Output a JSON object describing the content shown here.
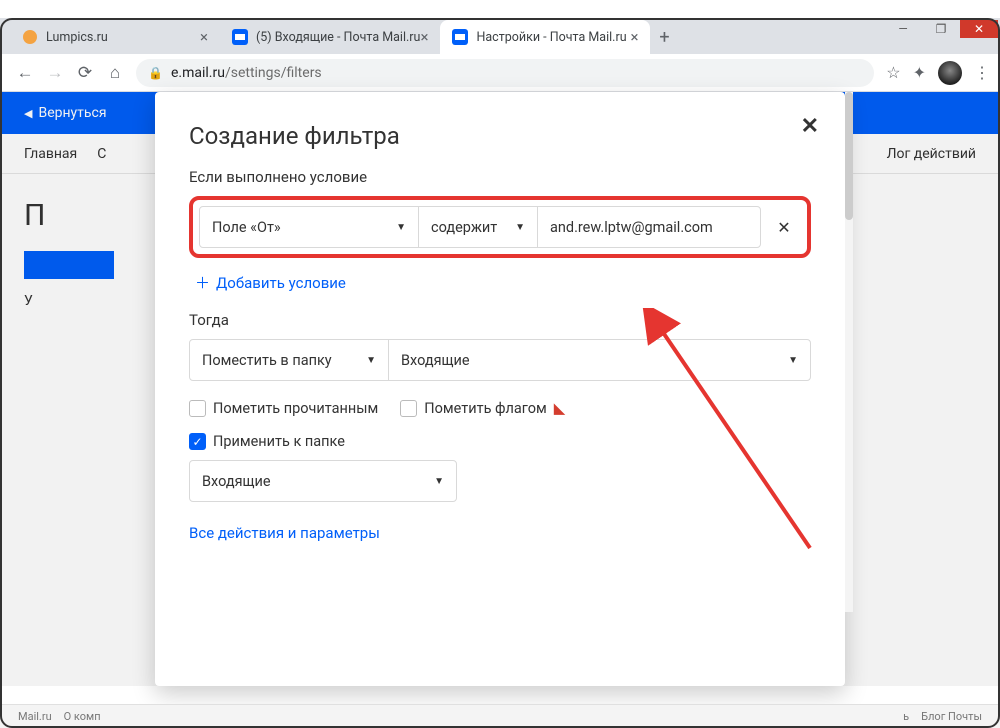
{
  "tabs": [
    {
      "label": "Lumpics.ru",
      "icon": "orange"
    },
    {
      "label": "(5) Входящие - Почта Mail.ru",
      "icon": "blue"
    },
    {
      "label": "Настройки - Почта Mail.ru",
      "icon": "blue"
    }
  ],
  "address": {
    "host": "e.mail.ru",
    "path": "/settings/filters"
  },
  "blueback": {
    "label": "Вернуться"
  },
  "nav": {
    "left": [
      "Главная",
      "С"
    ],
    "right": "Лог действий"
  },
  "pageBody": {
    "initial": "П",
    "under": "У"
  },
  "modal": {
    "title": "Создание фильтра",
    "cond_title": "Если выполнено условие",
    "field": "Поле «От»",
    "op": "содержит",
    "value": "and.rew.lptw@gmail.com",
    "add_cond": "Добавить условие",
    "then_title": "Тогда",
    "action": "Поместить в папку",
    "action_folder": "Входящие",
    "chk_read": "Пометить прочитанным",
    "chk_flag": "Пометить флагом",
    "chk_apply": "Применить к папке",
    "apply_folder": "Входящие",
    "all_link": "Все действия и параметры"
  },
  "footer": {
    "l": [
      "Mail.ru",
      "О комп"
    ],
    "r": [
      "ь",
      "Блог Почты"
    ]
  }
}
